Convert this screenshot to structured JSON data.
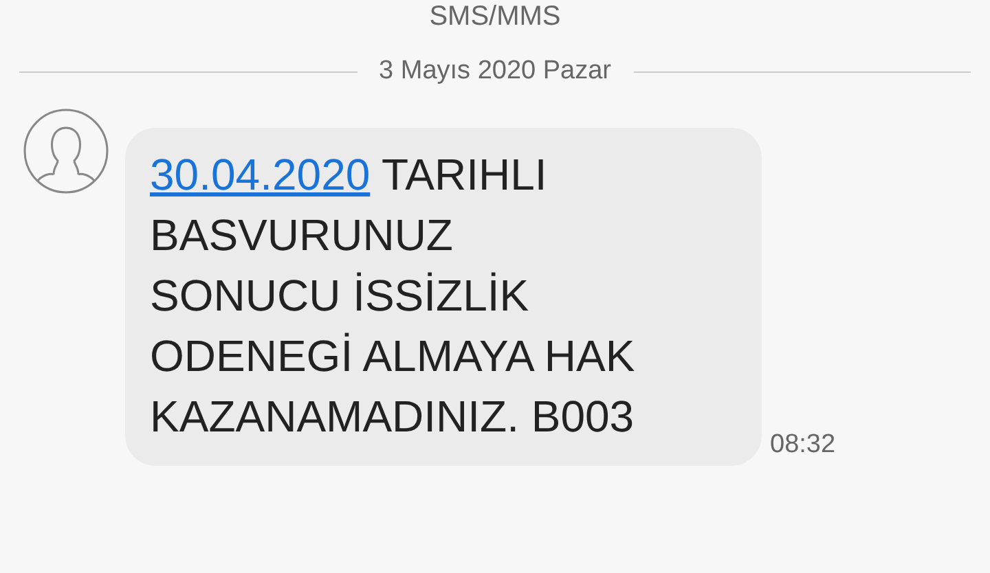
{
  "header": {
    "title": "SMS/MMS"
  },
  "date_divider": "3 Mayıs 2020 Pazar",
  "message": {
    "link": "30.04.2020",
    "text": "TARIHLI BASVURUNUZ SONUCU İSSİZLİK ODENEGİ ALMAYA HAK KAZANAMADINIZ. B003",
    "time": "08:32"
  }
}
